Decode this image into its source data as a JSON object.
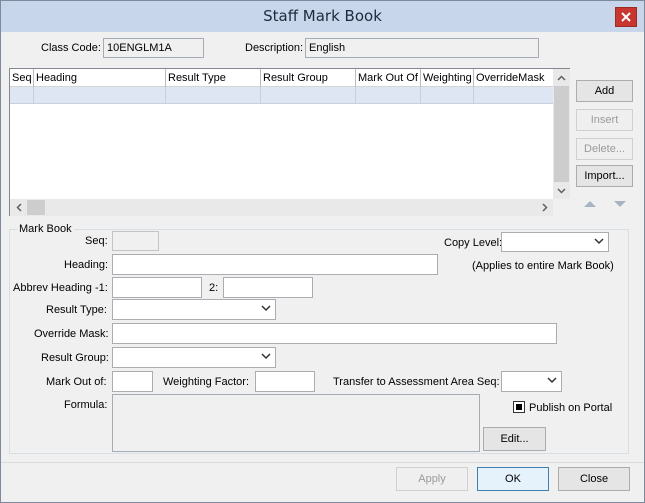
{
  "window": {
    "title": "Staff Mark Book",
    "close_icon": "close-icon"
  },
  "class_info": {
    "class_code_label": "Class Code:",
    "class_code_value": "10ENGLM1A",
    "description_label": "Description:",
    "description_value": "English"
  },
  "grid": {
    "columns": [
      "Seq",
      "Heading",
      "Result Type",
      "Result Group",
      "Mark Out Of",
      "Weighting",
      "OverrideMask"
    ],
    "rows": [
      [
        "",
        "",
        "",
        "",
        "",
        "",
        ""
      ]
    ]
  },
  "side_buttons": {
    "add": "Add",
    "insert": "Insert",
    "delete": "Delete...",
    "import": "Import...",
    "move_up_icon": "arrow-up-icon",
    "move_down_icon": "arrow-down-icon"
  },
  "markbook": {
    "group_title": "Mark Book",
    "seq_label": "Seq:",
    "seq_value": "",
    "copy_level_label": "Copy Level:",
    "copy_level_value": "",
    "copy_level_note": "(Applies to entire Mark Book)",
    "heading_label": "Heading:",
    "heading_value": "",
    "abbrev_label": "Abbrev Heading -1:",
    "abbrev_1_value": "",
    "abbrev_2_label": "2:",
    "abbrev_2_value": "",
    "result_type_label": "Result Type:",
    "result_type_value": "",
    "override_mask_label": "Override Mask:",
    "override_mask_value": "",
    "result_group_label": "Result Group:",
    "result_group_value": "",
    "mark_out_of_label": "Mark Out of:",
    "mark_out_of_value": "",
    "weighting_label": "Weighting Factor:",
    "weighting_value": "",
    "transfer_label": "Transfer to Assessment Area Seq:",
    "transfer_value": "",
    "formula_label": "Formula:",
    "formula_value": "",
    "publish_label": "Publish on Portal",
    "publish_checked": true,
    "edit_button": "Edit..."
  },
  "footer": {
    "apply": "Apply",
    "ok": "OK",
    "close": "Close"
  },
  "colors": {
    "titlebar": "#c7d6ea",
    "close_button": "#c7372f",
    "selected_row": "#dde6f2",
    "default_button_border": "#3c7fb1"
  }
}
